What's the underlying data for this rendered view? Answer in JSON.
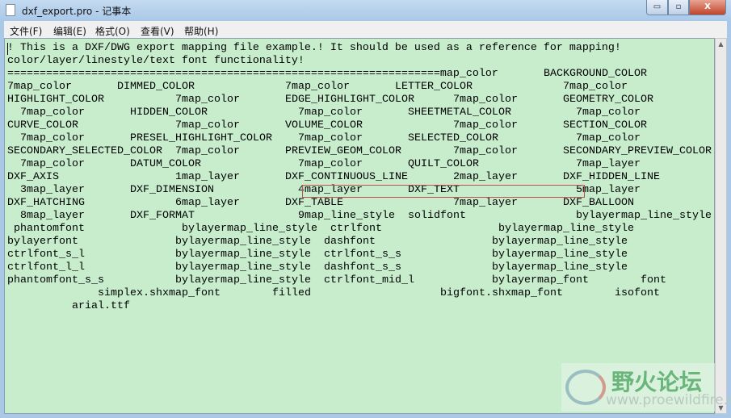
{
  "window": {
    "title": "dxf_export.pro - 记事本",
    "minimize": "▭",
    "maximize": "▫",
    "close": "X"
  },
  "menu": [
    {
      "label": "文件(F)"
    },
    {
      "label": "编辑(E)"
    },
    {
      "label": "格式(O)"
    },
    {
      "label": "查看(V)"
    },
    {
      "label": "帮助(H)"
    }
  ],
  "editor": {
    "lines": [
      [
        "! This is a DXF/DWG export mapping file example.! It should be used as a reference for mapping!"
      ],
      [
        "color/layer/linestyle/text font functionality!"
      ],
      [
        "===================================================================map_color",
        "BACKGROUND_COLOR"
      ],
      [
        "7map_color",
        "DIMMED_COLOR",
        "7map_color",
        "LETTER_COLOR",
        "7map_color"
      ],
      [
        "HIGHLIGHT_COLOR",
        "7map_color",
        "EDGE_HIGHLIGHT_COLOR",
        "7map_color",
        "GEOMETRY_COLOR"
      ],
      [
        "7map_color",
        "HIDDEN_COLOR",
        "7map_color",
        "SHEETMETAL_COLOR",
        "7map_color"
      ],
      [
        "CURVE_COLOR",
        "7map_color",
        "VOLUME_COLOR",
        "7map_color",
        "SECTION_COLOR"
      ],
      [
        "7map_color",
        "PRESEL_HIGHLIGHT_COLOR",
        "7map_color",
        "SELECTED_COLOR",
        "7map_color"
      ],
      [
        "SECONDARY_SELECTED_COLOR",
        "7map_color",
        "PREVIEW_GEOM_COLOR",
        "7map_color",
        "SECONDARY_PREVIEW_COLOR"
      ],
      [
        "7map_color",
        "DATUM_COLOR",
        "7map_color",
        "QUILT_COLOR",
        "7map_layer"
      ],
      [
        "DXF_AXIS",
        "1map_layer",
        "DXF_CONTINUOUS_LINE",
        "2map_layer",
        "DXF_HIDDEN_LINE"
      ],
      [
        "3map_layer",
        "DXF_DIMENSION",
        "4map_layer",
        "DXF_TEXT",
        "5map_layer"
      ],
      [
        "DXF_HATCHING",
        "6map_layer",
        "DXF_TABLE",
        "7map_layer",
        "DXF_BALLOON"
      ],
      [
        "8map_layer",
        "DXF_FORMAT",
        "9map_line_style",
        "solidfont",
        "bylayermap_line_style"
      ],
      [
        "phantomfont",
        "bylayermap_line_style",
        "ctrlfont",
        "bylayermap_line_style"
      ],
      [
        "bylayerfont",
        "bylayermap_line_style",
        "dashfont",
        "bylayermap_line_style"
      ],
      [
        "ctrlfont_s_l",
        "bylayermap_line_style",
        "ctrlfont_s_s",
        "bylayermap_line_style"
      ],
      [
        "ctrlfont_l_l",
        "bylayermap_line_style",
        "dashfont_s_s",
        "bylayermap_line_style"
      ],
      [
        "phantomfont_s_s",
        "bylayermap_line_style",
        "ctrlfont_mid_l",
        "bylayermap_font",
        "font"
      ],
      [
        "simplex.shxmap_font",
        "filled",
        "bigfont.shxmap_font",
        "isofont"
      ],
      [
        "arial.ttf"
      ]
    ]
  },
  "watermark": {
    "name": "野火论坛",
    "url": "www.proewildfire.cn"
  },
  "colors": {
    "editor_bg": "#c7edcc",
    "highlight_box": "#c0504d"
  }
}
